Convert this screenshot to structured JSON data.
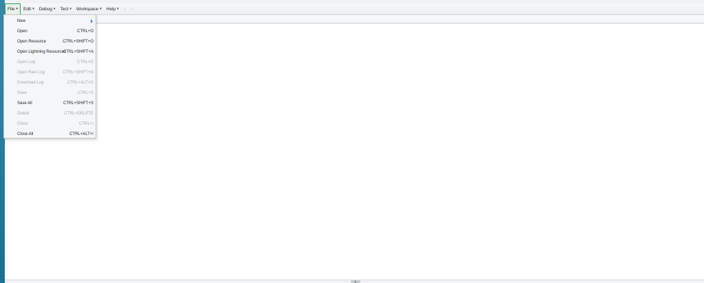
{
  "menubar": {
    "items": [
      {
        "label": "File",
        "caret": "▾",
        "active": true
      },
      {
        "label": "Edit",
        "caret": "▾"
      },
      {
        "label": "Debug",
        "caret": "▾"
      },
      {
        "label": "Test",
        "caret": "▾"
      },
      {
        "label": "Workspace",
        "caret": "▾"
      },
      {
        "label": "Help",
        "caret": "▾"
      }
    ],
    "back_icon": "‹",
    "forward_icon": "›"
  },
  "file_menu": {
    "items": [
      {
        "label": "New",
        "shortcut": "",
        "enabled": true,
        "submenu": true
      },
      {
        "label": "Open",
        "shortcut": "CTRL+O",
        "enabled": true
      },
      {
        "label": "Open Resource",
        "shortcut": "CTRL+SHIFT+O",
        "enabled": true
      },
      {
        "label": "Open Lightning Resources",
        "shortcut": "CTRL+SHIFT+A",
        "enabled": true
      },
      {
        "label": "Open Log",
        "shortcut": "CTRL+G",
        "enabled": false
      },
      {
        "label": "Open Raw Log",
        "shortcut": "CTRL+SHIFT+G",
        "enabled": false
      },
      {
        "label": "Download Log",
        "shortcut": "CTRL+ALT+G",
        "enabled": false
      },
      {
        "label": "Save",
        "shortcut": "CTRL+S",
        "enabled": false
      },
      {
        "label": "Save All",
        "shortcut": "CTRL+SHIFT+S",
        "enabled": true
      },
      {
        "label": "Delete",
        "shortcut": "CTRL+DELETE",
        "enabled": false
      },
      {
        "label": "Close",
        "shortcut": "CTRL+/",
        "enabled": false
      },
      {
        "label": "Close All",
        "shortcut": "CTRL+ALT+/",
        "enabled": true
      }
    ]
  },
  "splitter": {
    "icon": "▲"
  },
  "colors": {
    "active_menu_border": "#2e9a55",
    "submenu_arrow": "#3b7fd6",
    "disabled_text": "#a4a8ad"
  }
}
